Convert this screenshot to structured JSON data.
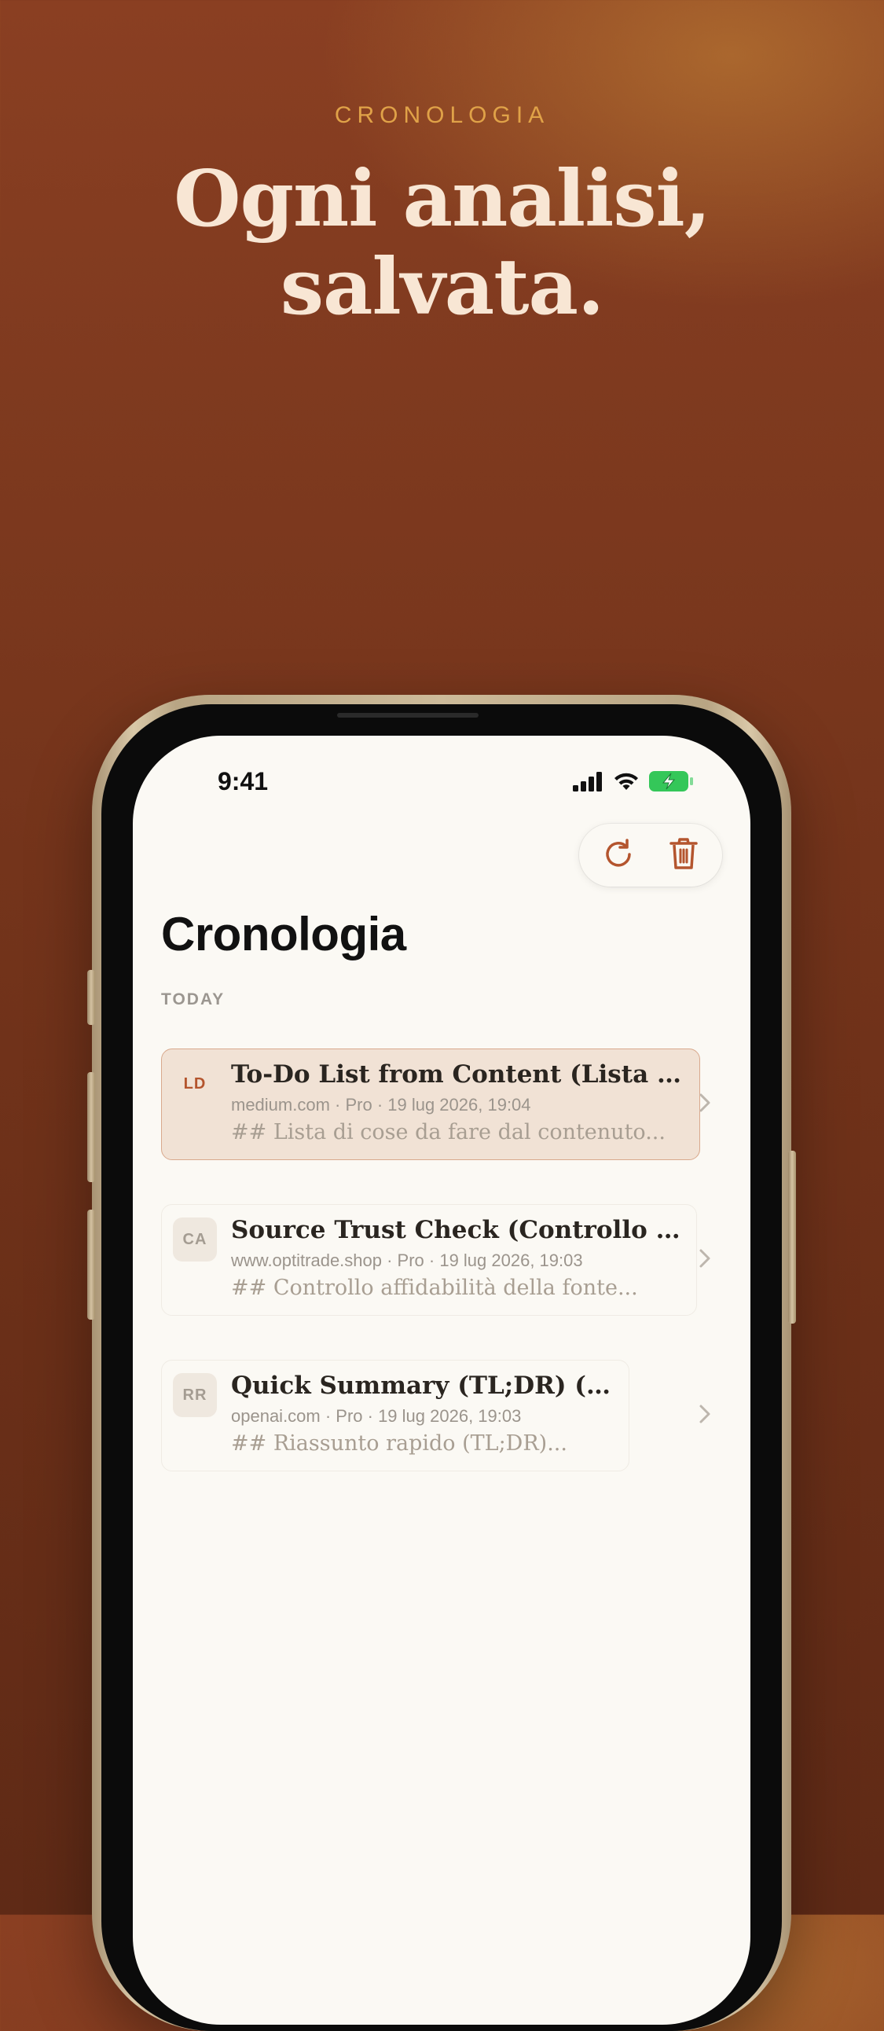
{
  "marketing": {
    "eyebrow": "CRONOLOGIA",
    "headline_line1": "Ogni analisi,",
    "headline_line2": "salvata."
  },
  "status_bar": {
    "time": "9:41"
  },
  "toolbar": {
    "icons": [
      "refresh-icon",
      "trash-icon"
    ]
  },
  "page": {
    "title": "Cronologia",
    "section_label": "TODAY"
  },
  "history": [
    {
      "initials": "LD",
      "title": "To-Do List from Content (Lista di cose da fare dal contenuto)",
      "meta": "medium.com · Pro · 19 lug 2026, 19:04",
      "snippet": "## Lista di cose da fare dal contenuto...",
      "selected": true
    },
    {
      "initials": "CA",
      "title": "Source Trust Check (Controllo affidabilità della fonte)",
      "meta": "www.optitrade.shop · Pro · 19 lug 2026, 19:03",
      "snippet": "## Controllo affidabilità della fonte...",
      "selected": false
    },
    {
      "initials": "RR",
      "title": "Quick Summary (TL;DR) (TL;DR)",
      "meta": "openai.com · Pro · 19 lug 2026, 19:03",
      "snippet": "## Riassunto rapido (TL;DR)...",
      "selected": false
    }
  ],
  "colors": {
    "accent": "#b4552e",
    "selected_row_bg": "#f1e2d5",
    "eyebrow": "#e0a248",
    "headline": "#f8e6d4",
    "battery": "#34c759"
  }
}
